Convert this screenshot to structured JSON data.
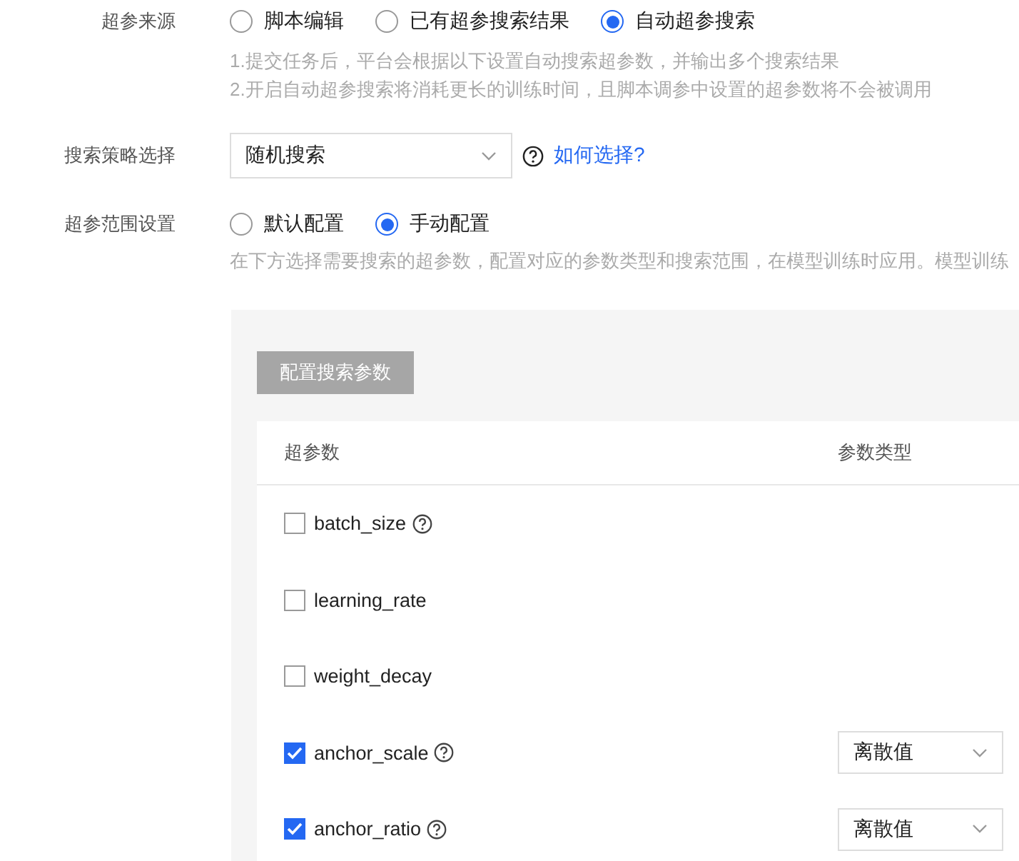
{
  "hyperparam_source": {
    "label": "超参来源",
    "options": [
      {
        "label": "脚本编辑",
        "selected": false
      },
      {
        "label": "已有超参搜索结果",
        "selected": false
      },
      {
        "label": "自动超参搜索",
        "selected": true
      }
    ],
    "hints": [
      "1.提交任务后，平台会根据以下设置自动搜索超参数，并输出多个搜索结果",
      "2.开启自动超参搜索将消耗更长的训练时间，且脚本调参中设置的超参数将不会被调用"
    ]
  },
  "search_strategy": {
    "label": "搜索策略选择",
    "value": "随机搜索",
    "help_link": "如何选择?"
  },
  "range_setting": {
    "label": "超参范围设置",
    "options": [
      {
        "label": "默认配置",
        "selected": false
      },
      {
        "label": "手动配置",
        "selected": true
      }
    ],
    "hint": "在下方选择需要搜索的超参数，配置对应的参数类型和搜索范围，在模型训练时应用。模型训练"
  },
  "config_button": {
    "label": "配置搜索参数",
    "disabled": true
  },
  "table": {
    "columns": [
      "超参数",
      "参数类型"
    ],
    "rows": [
      {
        "name": "batch_size",
        "checked": false,
        "help": true
      },
      {
        "name": "learning_rate",
        "checked": false,
        "help": false
      },
      {
        "name": "weight_decay",
        "checked": false,
        "help": false
      },
      {
        "name": "anchor_scale",
        "checked": true,
        "help": true,
        "type": "离散值"
      },
      {
        "name": "anchor_ratio",
        "checked": true,
        "help": true,
        "type": "离散值"
      }
    ]
  }
}
